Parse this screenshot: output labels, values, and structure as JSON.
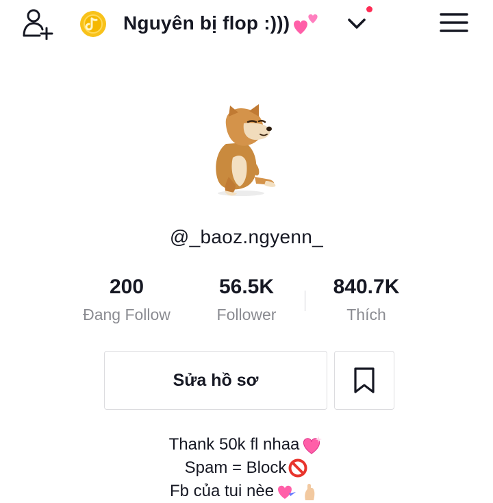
{
  "header": {
    "title": "Nguyên bị flop :)))",
    "title_emoji": "two-hearts-icon",
    "dropdown_icon": "chevron-down-icon",
    "notification_dot_color": "#fe2c55",
    "left_icons": [
      "add-user-icon",
      "coin-icon"
    ],
    "right_icon": "hamburger-menu-icon"
  },
  "profile": {
    "avatar": "shiba-dog-avatar",
    "username": "@_baoz.ngyenn_"
  },
  "stats": [
    {
      "value": "200",
      "label": "Đang Follow"
    },
    {
      "value": "56.5K",
      "label": "Follower"
    },
    {
      "value": "840.7K",
      "label": "Thích"
    }
  ],
  "actions": {
    "edit_label": "Sửa hồ sơ",
    "bookmark_icon": "bookmark-icon"
  },
  "bio": {
    "lines": [
      {
        "text": "Thank 50k fl nhaa",
        "emoji": "sparkling-heart-icon"
      },
      {
        "text": "Spam = Block",
        "emoji": "prohibited-icon"
      },
      {
        "text": "Fb của tui nèe",
        "emoji": "hearts-and-hand-icons"
      }
    ]
  },
  "colors": {
    "accent_red": "#fe2c55",
    "text": "#161823",
    "secondary_text": "#8a8b91",
    "border": "#dcdcdf",
    "coin": "#f5b800"
  }
}
